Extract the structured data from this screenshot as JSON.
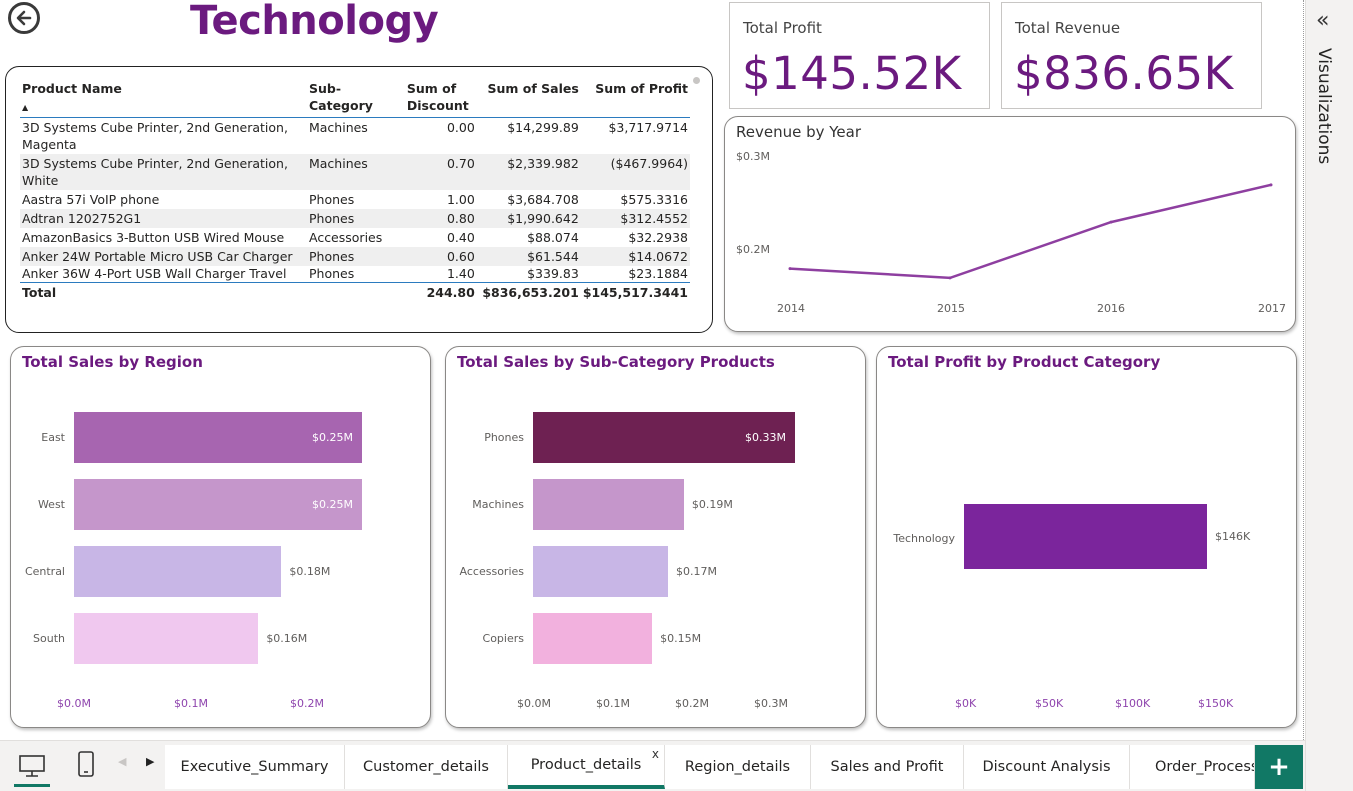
{
  "page_title": "Technology",
  "kpis": {
    "profit": {
      "label": "Total Profit",
      "value": "$145.52K"
    },
    "revenue": {
      "label": "Total Revenue",
      "value": "$836.65K"
    }
  },
  "table": {
    "headers": {
      "name": "Product Name",
      "subcat": "Sub-Category",
      "discount": "Sum of Discount",
      "sales": "Sum of Sales",
      "profit": "Sum of Profit"
    },
    "rows": [
      {
        "name": "3D Systems Cube Printer, 2nd Generation, Magenta",
        "subcat": "Machines",
        "discount": "0.00",
        "sales": "$14,299.89",
        "profit": "$3,717.9714"
      },
      {
        "name": "3D Systems Cube Printer, 2nd Generation, White",
        "subcat": "Machines",
        "discount": "0.70",
        "sales": "$2,339.982",
        "profit": "($467.9964)"
      },
      {
        "name": "Aastra 57i VoIP phone",
        "subcat": "Phones",
        "discount": "1.00",
        "sales": "$3,684.708",
        "profit": "$575.3316"
      },
      {
        "name": "Adtran 1202752G1",
        "subcat": "Phones",
        "discount": "0.80",
        "sales": "$1,990.642",
        "profit": "$312.4552"
      },
      {
        "name": "AmazonBasics 3-Button USB Wired Mouse",
        "subcat": "Accessories",
        "discount": "0.40",
        "sales": "$88.074",
        "profit": "$32.2938"
      },
      {
        "name": "Anker 24W Portable Micro USB Car Charger",
        "subcat": "Phones",
        "discount": "0.60",
        "sales": "$61.544",
        "profit": "$14.0672"
      },
      {
        "name": "Anker 36W 4-Port USB Wall Charger Travel",
        "subcat": "Phones",
        "discount": "1.40",
        "sales": "$339.83",
        "profit": "$23.1884"
      }
    ],
    "total": {
      "label": "Total",
      "discount": "244.80",
      "sales": "$836,653.201",
      "profit": "$145,517.3441"
    }
  },
  "revenue_chart": {
    "title": "Revenue by Year",
    "y_ticks": [
      "$0.3M",
      "$0.2M"
    ],
    "x_ticks": [
      "2014",
      "2015",
      "2016",
      "2017"
    ]
  },
  "region_chart": {
    "title": "Total Sales by Region",
    "x_ticks": [
      "$0.0M",
      "$0.1M",
      "$0.2M"
    ],
    "bars": [
      {
        "cat": "East",
        "label": "$0.25M",
        "color": "#a765b0"
      },
      {
        "cat": "West",
        "label": "$0.25M",
        "color": "#c596cb"
      },
      {
        "cat": "Central",
        "label": "$0.18M",
        "color": "#c8b6e6"
      },
      {
        "cat": "South",
        "label": "$0.16M",
        "color": "#f0c8ef"
      }
    ]
  },
  "subcat_chart": {
    "title": "Total Sales by Sub-Category Products",
    "x_ticks": [
      "$0.0M",
      "$0.1M",
      "$0.2M",
      "$0.3M"
    ],
    "bars": [
      {
        "cat": "Phones",
        "label": "$0.33M",
        "color": "#6e2152"
      },
      {
        "cat": "Machines",
        "label": "$0.19M",
        "color": "#c596cb"
      },
      {
        "cat": "Accessories",
        "label": "$0.17M",
        "color": "#c8b6e6"
      },
      {
        "cat": "Copiers",
        "label": "$0.15M",
        "color": "#f2b1de"
      }
    ]
  },
  "category_chart": {
    "title": "Total Profit by Product Category",
    "x_ticks": [
      "$0K",
      "$50K",
      "$100K",
      "$150K"
    ],
    "bars": [
      {
        "cat": "Technology",
        "label": "$146K",
        "color": "#7b259c"
      }
    ]
  },
  "chart_data": [
    {
      "type": "line",
      "title": "Revenue by Year",
      "x": [
        2014,
        2015,
        2016,
        2017
      ],
      "values": [
        0.18,
        0.17,
        0.23,
        0.27
      ],
      "ylabel": "",
      "xlabel": ""
    },
    {
      "type": "bar",
      "title": "Total Sales by Region",
      "categories": [
        "East",
        "West",
        "Central",
        "South"
      ],
      "values": [
        0.25,
        0.25,
        0.18,
        0.16
      ],
      "xlim": [
        0,
        0.25
      ]
    },
    {
      "type": "bar",
      "title": "Total Sales by Sub-Category Products",
      "categories": [
        "Phones",
        "Machines",
        "Accessories",
        "Copiers"
      ],
      "values": [
        0.33,
        0.19,
        0.17,
        0.15
      ],
      "xlim": [
        0,
        0.33
      ]
    },
    {
      "type": "bar",
      "title": "Total Profit by Product Category",
      "categories": [
        "Technology"
      ],
      "values": [
        146
      ],
      "xlim": [
        0,
        150
      ]
    }
  ],
  "side_panel": {
    "label": "Visualizations"
  },
  "tabs": [
    {
      "label": "Executive_Summary"
    },
    {
      "label": "Customer_details"
    },
    {
      "label": "Product_details"
    },
    {
      "label": "Region_details"
    },
    {
      "label": "Sales and Profit"
    },
    {
      "label": "Discount Analysis"
    },
    {
      "label": "Order_Processi"
    }
  ],
  "tab_close": "x",
  "add_label": "+"
}
